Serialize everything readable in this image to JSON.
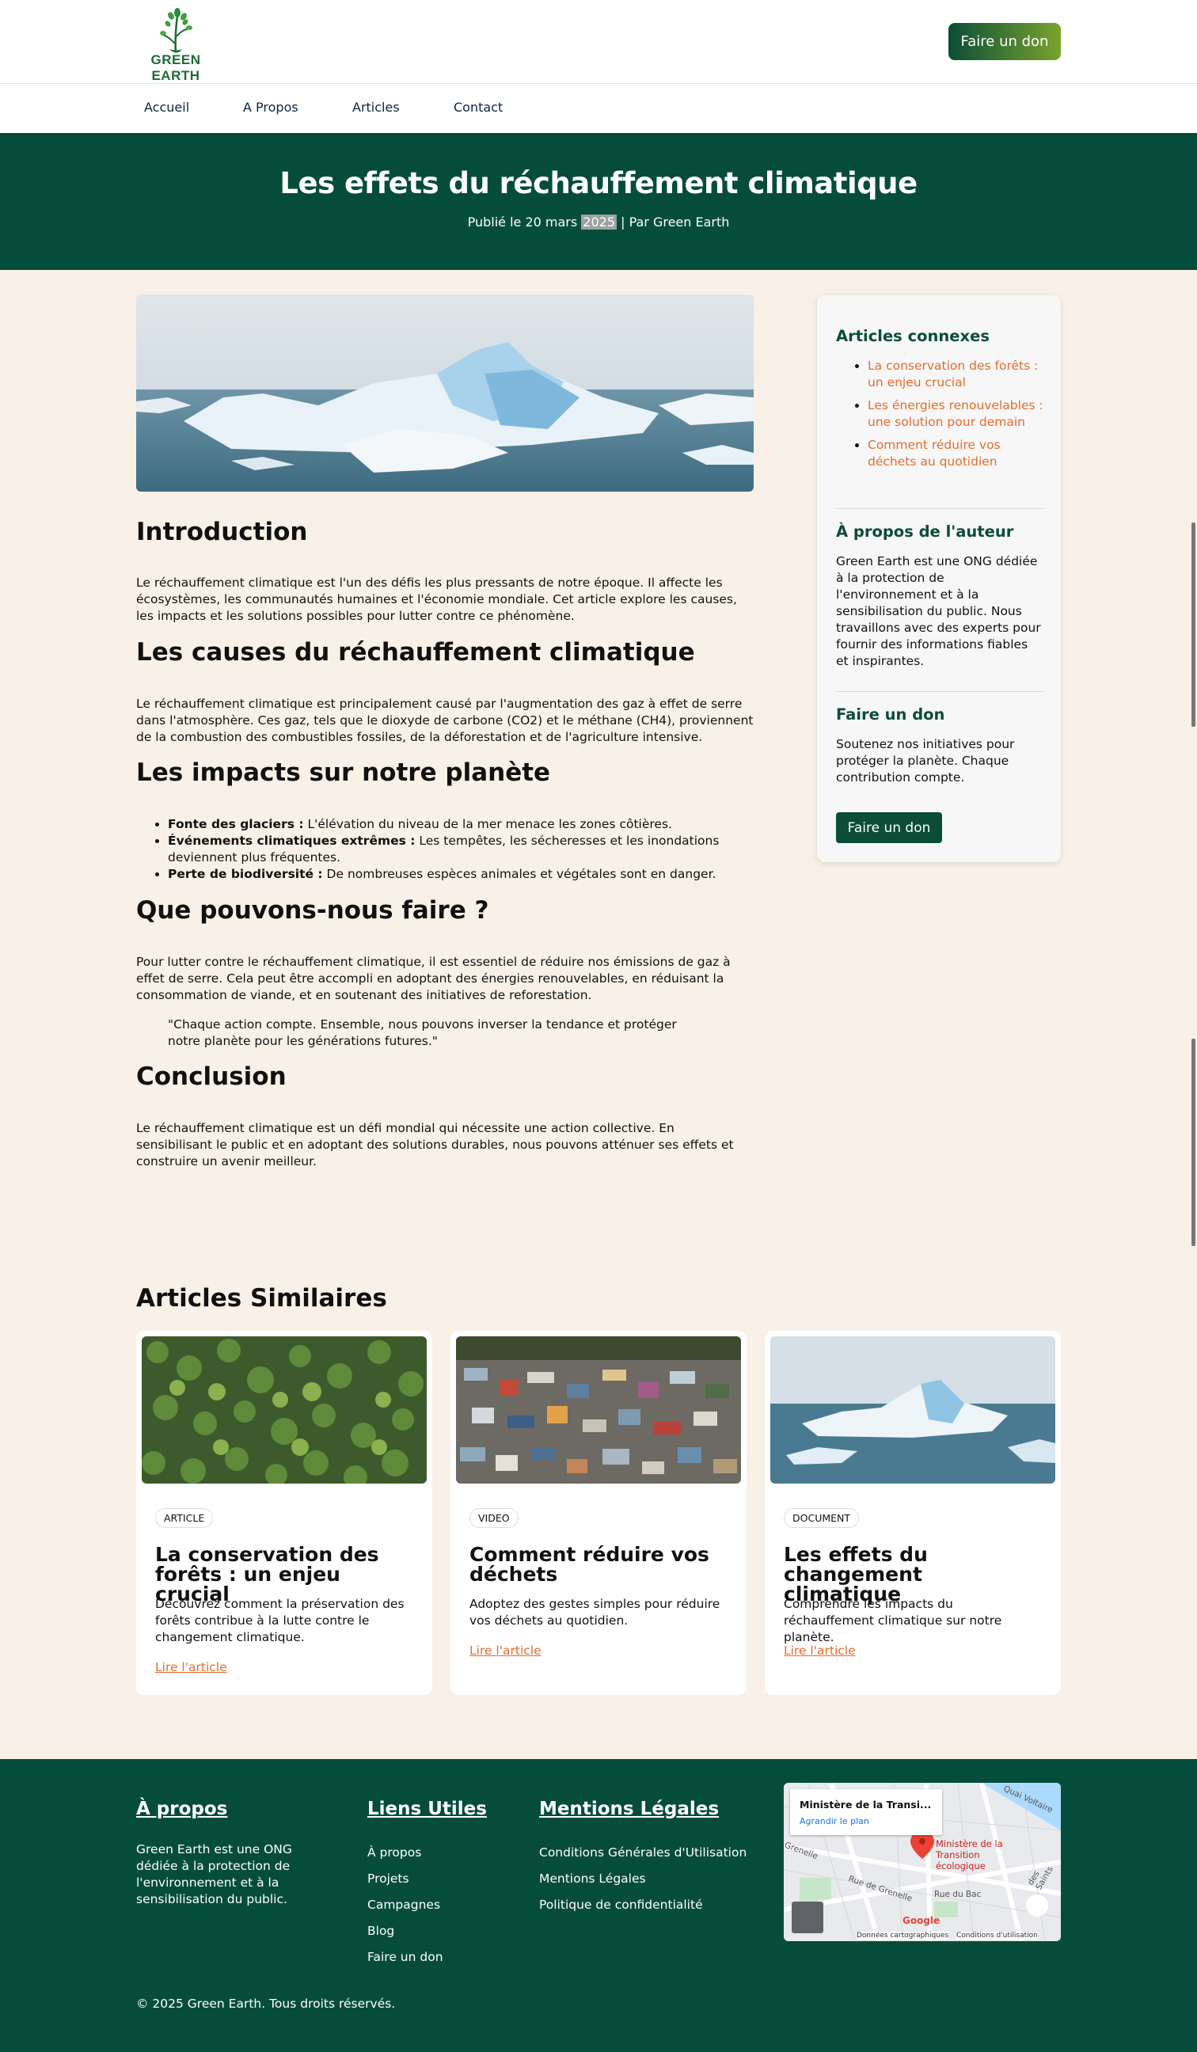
{
  "brand": {
    "name": "GREEN EARTH",
    "accent": "#054d3a",
    "orange": "#e66b2b"
  },
  "header": {
    "donate_label": "Faire un don"
  },
  "nav": {
    "items": [
      "Accueil",
      "A Propos",
      "Articles",
      "Contact"
    ]
  },
  "hero": {
    "title": "Les effets du réchauffement climatique",
    "meta_prefix": "Publié le 20 mars ",
    "meta_year": "2025",
    "meta_suffix": " | Par Green Earth"
  },
  "article": {
    "intro_title": "Introduction",
    "intro_text": "Le réchauffement climatique est l'un des défis les plus pressants de notre époque. Il affecte les écosystèmes, les communautés humaines et l'économie mondiale. Cet article explore les causes, les impacts et les solutions possibles pour lutter contre ce phénomène.",
    "causes_title": "Les causes du réchauffement climatique",
    "causes_text": "Le réchauffement climatique est principalement causé par l'augmentation des gaz à effet de serre dans l'atmosphère. Ces gaz, tels que le dioxyde de carbone (CO2) et le méthane (CH4), proviennent de la combustion des combustibles fossiles, de la déforestation et de l'agriculture intensive.",
    "impacts_title": "Les impacts sur notre planète",
    "impacts": [
      {
        "label": "Fonte des glaciers :",
        "text": " L'élévation du niveau de la mer menace les zones côtières."
      },
      {
        "label": "Événements climatiques extrêmes :",
        "text": " Les tempêtes, les sécheresses et les inondations deviennent plus fréquentes."
      },
      {
        "label": "Perte de biodiversité :",
        "text": " De nombreuses espèces animales et végétales sont en danger."
      }
    ],
    "actions_title": "Que pouvons-nous faire ?",
    "actions_text": "Pour lutter contre le réchauffement climatique, il est essentiel de réduire nos émissions de gaz à effet de serre. Cela peut être accompli en adoptant des énergies renouvelables, en réduisant la consommation de viande, et en soutenant des initiatives de reforestation.",
    "quote": "\"Chaque action compte. Ensemble, nous pouvons inverser la tendance et protéger notre planète pour les générations futures.\"",
    "conclusion_title": "Conclusion",
    "conclusion_text": "Le réchauffement climatique est un défi mondial qui nécessite une action collective. En sensibilisant le public et en adoptant des solutions durables, nous pouvons atténuer ses effets et construire un avenir meilleur."
  },
  "sidebar": {
    "related_title": "Articles connexes",
    "related": [
      "La conservation des forêts : un enjeu crucial",
      "Les énergies renouvelables : une solution pour demain",
      "Comment réduire vos déchets au quotidien"
    ],
    "author_title": "À propos de l'auteur",
    "author_text": "Green Earth est une ONG dédiée à la protection de l'environnement et à la sensibilisation du public. Nous travaillons avec des experts pour fournir des informations fiables et inspirantes.",
    "donate_title": "Faire un don",
    "donate_text": "Soutenez nos initiatives pour protéger la planète. Chaque contribution compte.",
    "donate_button": "Faire un don"
  },
  "similar": {
    "title": "Articles Similaires",
    "cards": [
      {
        "badge": "ARTICLE",
        "title": "La conservation des forêts : un enjeu crucial",
        "text": "Découvrez comment la préservation des forêts contribue à la lutte contre le changement climatique.",
        "link": "Lire l'article",
        "image": "forest"
      },
      {
        "badge": "VIDEO",
        "title": "Comment réduire vos déchets",
        "text": "Adoptez des gestes simples pour réduire vos déchets au quotidien.",
        "link": "Lire l'article",
        "image": "waste"
      },
      {
        "badge": "DOCUMENT",
        "title": "Les effets du changement climatique",
        "text": "Comprendre les impacts du réchauffement climatique sur notre planète.",
        "link": "Lire l'article",
        "image": "iceberg"
      }
    ]
  },
  "footer": {
    "about_title": "À propos",
    "about_text": "Green Earth est une ONG dédiée à la protection de l'environnement et à la sensibilisation du public.",
    "links_title": "Liens Utiles",
    "links": [
      "À propos",
      "Projets",
      "Campagnes",
      "Blog",
      "Faire un don"
    ],
    "legal_title": "Mentions Légales",
    "legal": [
      "Conditions Générales d'Utilisation",
      "Mentions Légales",
      "Politique de confidentialité"
    ],
    "copyright": "© 2025 Green Earth. Tous droits réservés.",
    "map": {
      "place": "Ministère de la Transi...",
      "enlarge": "Agrandir le plan",
      "marker_label": "Ministère de la Transition écologique",
      "streets": [
        "Quai Voltaire",
        "Rue du Bac",
        "Rue de Grenelle",
        "Grenelle",
        "des Saints"
      ],
      "attribution": [
        "Données cartographiques",
        "Conditions d'utilisation"
      ],
      "google": "Google"
    }
  }
}
